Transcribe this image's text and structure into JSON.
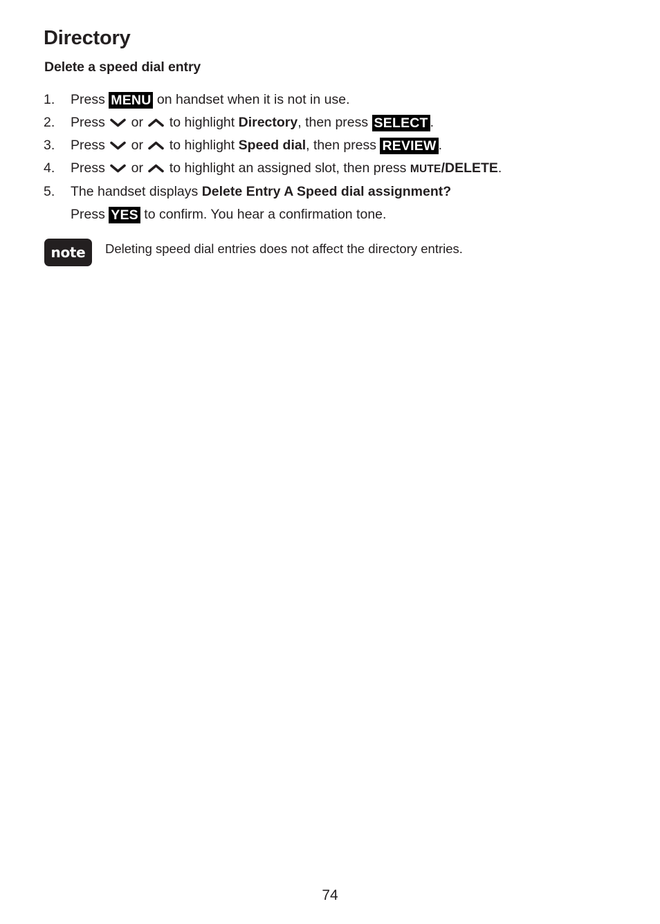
{
  "document": {
    "chapter_title": "Directory",
    "section_title": "Delete a speed dial entry",
    "page_number": "74"
  },
  "steps": [
    {
      "number": "1.",
      "parts": [
        {
          "type": "text",
          "value": "Press "
        },
        {
          "type": "key",
          "value": "MENU"
        },
        {
          "type": "text",
          "value": " on handset when it is not in use."
        }
      ]
    },
    {
      "number": "2.",
      "parts": [
        {
          "type": "text",
          "value": "Press "
        },
        {
          "type": "icon",
          "value": "chevron-down-icon"
        },
        {
          "type": "text",
          "value": " or "
        },
        {
          "type": "icon",
          "value": "chevron-up-icon"
        },
        {
          "type": "text",
          "value": " to highlight "
        },
        {
          "type": "bold",
          "value": "Directory"
        },
        {
          "type": "text",
          "value": ", then press "
        },
        {
          "type": "key",
          "value": "SELECT"
        },
        {
          "type": "text",
          "value": "."
        }
      ]
    },
    {
      "number": "3.",
      "parts": [
        {
          "type": "text",
          "value": "Press "
        },
        {
          "type": "icon",
          "value": "chevron-down-icon"
        },
        {
          "type": "text",
          "value": " or "
        },
        {
          "type": "icon",
          "value": "chevron-up-icon"
        },
        {
          "type": "text",
          "value": " to highlight "
        },
        {
          "type": "bold",
          "value": "Speed dial"
        },
        {
          "type": "text",
          "value": ", then press "
        },
        {
          "type": "key",
          "value": "REVIEW"
        },
        {
          "type": "text",
          "value": "."
        }
      ]
    },
    {
      "number": "4.",
      "parts": [
        {
          "type": "text",
          "value": "Press "
        },
        {
          "type": "icon",
          "value": "chevron-down-icon"
        },
        {
          "type": "text",
          "value": " or "
        },
        {
          "type": "icon",
          "value": "chevron-up-icon"
        },
        {
          "type": "text",
          "value": " to highlight an assigned slot, then press "
        },
        {
          "type": "smallcaps",
          "value": "MUTE"
        },
        {
          "type": "fullcaps",
          "value": "/DELETE"
        },
        {
          "type": "text",
          "value": "."
        }
      ]
    },
    {
      "number": "5.",
      "lines": [
        [
          {
            "type": "text",
            "value": "The handset displays "
          },
          {
            "type": "bold",
            "value": "Delete Entry A Speed dial assignment?"
          }
        ],
        [
          {
            "type": "text",
            "value": "Press "
          },
          {
            "type": "key",
            "value": "YES"
          },
          {
            "type": "text",
            "value": " to confirm. You hear a confirmation tone."
          }
        ]
      ]
    }
  ],
  "note": {
    "badge_label": "note",
    "text": "Deleting speed dial entries does not affect the directory entries."
  },
  "colors": {
    "text": "#231f20",
    "key_background": "#000000",
    "key_foreground": "#ffffff",
    "page_background": "#ffffff"
  }
}
